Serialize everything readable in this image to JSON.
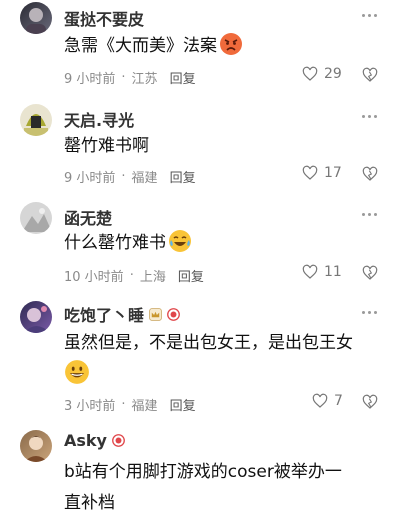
{
  "comments": [
    {
      "username": "蛋挞不要皮",
      "text": "急需《大而美》法案",
      "emoji": "angry-face-icon",
      "time": "9 小时前",
      "location": "江苏",
      "reply": "回复",
      "likes": "29"
    },
    {
      "username": "天启.寻光",
      "text": "罄竹难书啊",
      "time": "9 小时前",
      "location": "福建",
      "reply": "回复",
      "likes": "17"
    },
    {
      "username": "函无楚",
      "text": "什么罄竹难书",
      "emoji": "laughing-crying-face-icon",
      "time": "10 小时前",
      "location": "上海",
      "reply": "回复",
      "likes": "11"
    },
    {
      "username": "吃饱了丶睡",
      "badges": [
        "crown-badge-icon",
        "red-badge-icon"
      ],
      "text_line1": "虽然但是，不是出包女王，是出包王女",
      "emoji": "grinning-face-icon",
      "time": "3 小时前",
      "location": "福建",
      "reply": "回复",
      "likes": "7"
    },
    {
      "username": "Asky",
      "badges": [
        "red-badge-icon"
      ],
      "text_line1": "b站有个用脚打游戏的coser被举办一",
      "text_line2": "直补档"
    }
  ],
  "colors": {
    "meta_gray": "#8a8a8a",
    "text": "#111111",
    "badge_red": "#e0464a"
  }
}
